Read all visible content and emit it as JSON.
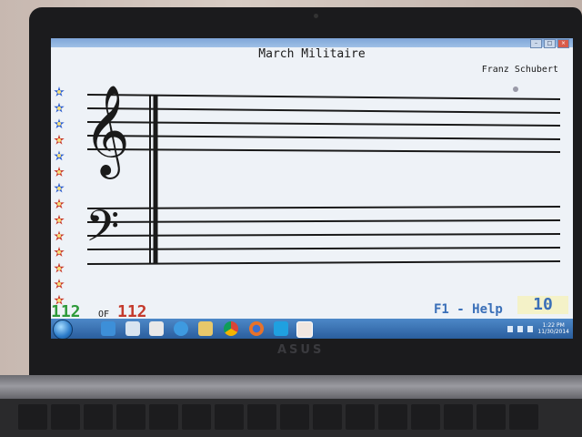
{
  "app": {
    "song_title": "March Militaire",
    "composer": "Franz Schubert"
  },
  "counter": {
    "current": "112",
    "of_label": "OF",
    "total": "112"
  },
  "help_label": "F1 - Help",
  "tempo_value": "10",
  "window_controls": [
    "minimize",
    "maximize",
    "close"
  ],
  "flowers": [
    "blue",
    "blue",
    "blue",
    "red",
    "blue",
    "red",
    "blue",
    "red",
    "red",
    "red",
    "red",
    "red",
    "red",
    "red"
  ],
  "colors": {
    "counter_current": "#2e9a3a",
    "counter_total": "#c43a2c",
    "help_text": "#3a6fb8",
    "flower_blue": "#2f5fd0",
    "flower_red": "#c93b2c",
    "taskbar": "#2a5e9d"
  },
  "taskbar_icons": [
    "start-orb",
    "ie-icon",
    "explorer-icon",
    "media-icon",
    "chrome-icon",
    "firefox-icon",
    "skype-icon",
    "music-app-icon"
  ],
  "tray": {
    "clock_time": "1:22 PM",
    "clock_date": "11/30/2014"
  },
  "brand": "ASUS"
}
